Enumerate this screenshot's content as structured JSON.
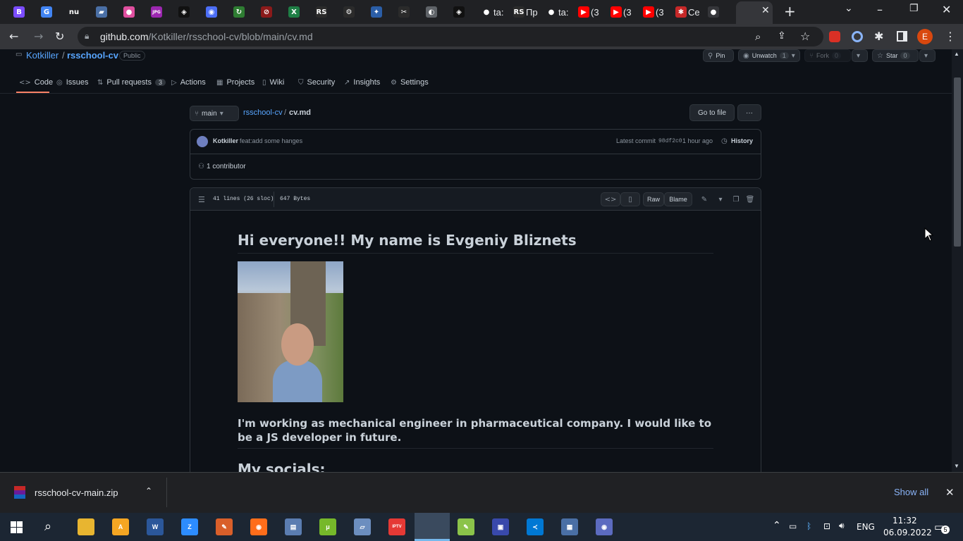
{
  "browser": {
    "tabs": [
      {
        "icon": "b-icon",
        "glyph": "B",
        "color": "#7b4cff",
        "label": ""
      },
      {
        "icon": "translate-icon",
        "glyph": "G",
        "color": "#4285f4",
        "label": ""
      },
      {
        "icon": "nu-icon",
        "glyph": "nu",
        "color": "#202124",
        "label": ""
      },
      {
        "icon": "book-icon",
        "glyph": "▰",
        "color": "#4a6fa5",
        "label": ""
      },
      {
        "icon": "color-wheel-icon",
        "glyph": "●",
        "color": "#e04f9f",
        "label": ""
      },
      {
        "icon": "jpg-icon",
        "glyph": "JPG",
        "color": "#9c27b0",
        "label": ""
      },
      {
        "icon": "codepen-icon",
        "glyph": "◈",
        "color": "#111111",
        "label": ""
      },
      {
        "icon": "chrome-icon",
        "glyph": "◉",
        "color": "#4c6ef5",
        "label": ""
      },
      {
        "icon": "refresh-icon",
        "glyph": "↻",
        "color": "#2e7d32",
        "label": ""
      },
      {
        "icon": "rs-icon",
        "glyph": "⊘",
        "color": "#8b1a1a",
        "label": ""
      },
      {
        "icon": "excel-icon",
        "glyph": "X",
        "color": "#1e7e45",
        "label": ""
      },
      {
        "icon": "rs-school-icon",
        "glyph": "RS",
        "color": "#2b2b2b",
        "label": ""
      },
      {
        "icon": "gear-icon",
        "glyph": "⚙",
        "color": "#2b2b2b",
        "label": ""
      },
      {
        "icon": "pin-icon",
        "glyph": "✦",
        "color": "#2b5ea7",
        "label": ""
      },
      {
        "icon": "scissors-icon",
        "glyph": "✂",
        "color": "#2b2b2b",
        "label": ""
      },
      {
        "icon": "globe-icon",
        "glyph": "◐",
        "color": "#5f6368",
        "label": ""
      },
      {
        "icon": "codepen-icon",
        "glyph": "◈",
        "color": "#111111",
        "label": ""
      },
      {
        "icon": "github-icon",
        "glyph": "●",
        "color": "#202124",
        "label": "ta:"
      },
      {
        "icon": "rs-school-icon",
        "glyph": "RS",
        "color": "#2b2b2b",
        "label": "Пр"
      },
      {
        "icon": "github-icon",
        "glyph": "●",
        "color": "#202124",
        "label": "ta:"
      },
      {
        "icon": "youtube-icon",
        "glyph": "▶",
        "color": "#ff0000",
        "label": "(3"
      },
      {
        "icon": "youtube-icon",
        "glyph": "▶",
        "color": "#ff0000",
        "label": "(3"
      },
      {
        "icon": "youtube-icon",
        "glyph": "▶",
        "color": "#ff0000",
        "label": "(3"
      },
      {
        "icon": "puzzle-icon",
        "glyph": "✱",
        "color": "#c62828",
        "label": "Ce"
      },
      {
        "icon": "github-icon",
        "glyph": "●",
        "color": "#35363a",
        "label": ""
      }
    ],
    "url_host": "github.com",
    "url_path": "/Kotkiller/rsschool-cv/blob/main/cv.md",
    "profile_letter": "E"
  },
  "repo": {
    "owner": "Kotkiller",
    "sep": "/",
    "name": "rsschool-cv",
    "visibility": "Public",
    "pin": "Pin",
    "unwatch": "Unwatch",
    "watch_count": "1",
    "fork": "Fork",
    "fork_count": "0",
    "star": "Star",
    "star_count": "0"
  },
  "nav": {
    "code": "Code",
    "issues": "Issues",
    "pulls": "Pull requests",
    "pulls_count": "3",
    "actions": "Actions",
    "projects": "Projects",
    "wiki": "Wiki",
    "security": "Security",
    "insights": "Insights",
    "settings": "Settings"
  },
  "file": {
    "branch": "main",
    "crumb_repo": "rsschool-cv",
    "crumb_sep": "/",
    "crumb_file": "cv.md",
    "go_to_file": "Go to file",
    "more": "···",
    "commit_author": "Kotkiller",
    "commit_msg": "feat:add some hanges",
    "latest_commit": "Latest commit",
    "commit_sha": "98df2c0",
    "commit_time": "1 hour ago",
    "history": "History",
    "contributors": "1 contributor",
    "lines": "41 lines (26 sloc)",
    "size": "647 Bytes",
    "raw": "Raw",
    "blame": "Blame"
  },
  "markdown": {
    "heading": "Hi everyone!! My name is Evgeniy Bliznets",
    "paragraph": "I'm working as mechanical engineer in pharmaceutical company. I would like to be a JS developer in future.",
    "heading2": "My socials:"
  },
  "downloads": {
    "file": "rsschool-cv-main.zip",
    "show_all": "Show all"
  },
  "taskbar": {
    "apps": [
      {
        "icon": "folder-icon",
        "color": "#e8b530",
        "glyph": ""
      },
      {
        "icon": "aimp-icon",
        "color": "#f5a623",
        "glyph": "A"
      },
      {
        "icon": "word-icon",
        "color": "#2b579a",
        "glyph": "W"
      },
      {
        "icon": "zoom-icon",
        "color": "#2d8cff",
        "glyph": "Z"
      },
      {
        "icon": "paint-icon",
        "color": "#d95f2a",
        "glyph": "✎"
      },
      {
        "icon": "firefox-icon",
        "color": "#ff6d1a",
        "glyph": "◉"
      },
      {
        "icon": "scanner-icon",
        "color": "#5b7db1",
        "glyph": "▤"
      },
      {
        "icon": "utorrent-icon",
        "color": "#76b82a",
        "glyph": "μ"
      },
      {
        "icon": "terminal-icon",
        "color": "#6c8ebf",
        "glyph": "▱"
      },
      {
        "icon": "iptv-icon",
        "color": "#e53935",
        "glyph": "IPTV"
      },
      {
        "icon": "chrome-icon",
        "color": "#db4437",
        "glyph": "◉"
      },
      {
        "icon": "notepad-icon",
        "color": "#8bc34a",
        "glyph": "✎"
      },
      {
        "icon": "save-icon",
        "color": "#3949ab",
        "glyph": "▣"
      },
      {
        "icon": "vscode-icon",
        "color": "#0078d4",
        "glyph": "≺"
      },
      {
        "icon": "calculator-icon",
        "color": "#4a6fa5",
        "glyph": "▦"
      },
      {
        "icon": "chrome-alt-icon",
        "color": "#5c6bc0",
        "glyph": "◉"
      }
    ],
    "lang": "ENG",
    "time": "11:32",
    "date": "06.09.2022",
    "notifications": "5"
  }
}
